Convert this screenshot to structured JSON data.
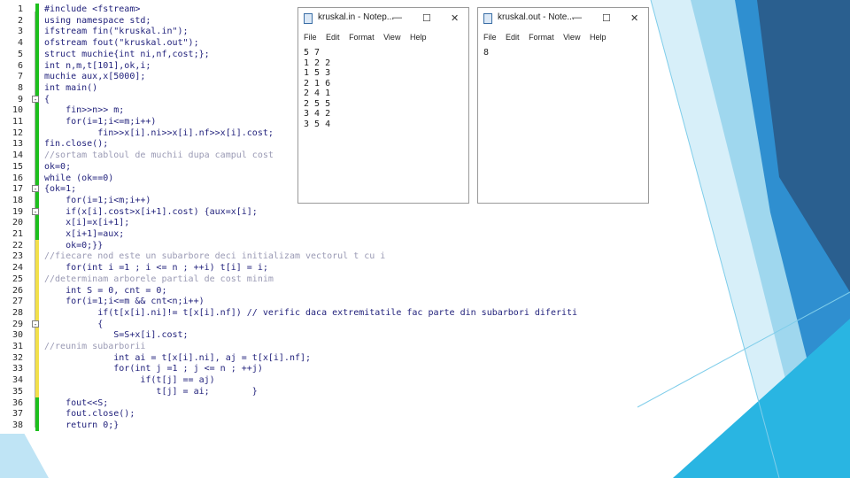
{
  "code_lines": [
    {
      "n": "1",
      "text": "#include <fstream>",
      "color": "plain",
      "bar": "green"
    },
    {
      "n": "2",
      "text": "using namespace std;",
      "color": "plain",
      "bar": "green"
    },
    {
      "n": "3",
      "text": "ifstream fin(\"kruskal.in\");",
      "color": "plain",
      "bar": "green"
    },
    {
      "n": "4",
      "text": "ofstream fout(\"kruskal.out\");",
      "color": "plain",
      "bar": "green"
    },
    {
      "n": "5",
      "text": "struct muchie{int ni,nf,cost;};",
      "color": "plain",
      "bar": "green"
    },
    {
      "n": "6",
      "text": "int n,m,t[101],ok,i;",
      "color": "plain",
      "bar": "green"
    },
    {
      "n": "7",
      "text": "muchie aux,x[5000];",
      "color": "plain",
      "bar": "green"
    },
    {
      "n": "8",
      "text": "int main()",
      "color": "plain",
      "bar": "green"
    },
    {
      "n": "9",
      "text": "{",
      "color": "plain",
      "bar": "green",
      "fold": "-"
    },
    {
      "n": "10",
      "text": "    fin>>n>> m;",
      "color": "plain",
      "bar": "green"
    },
    {
      "n": "11",
      "text": "    for(i=1;i<=m;i++)",
      "color": "plain",
      "bar": "green"
    },
    {
      "n": "12",
      "text": "          fin>>x[i].ni>>x[i].nf>>x[i].cost;",
      "color": "plain",
      "bar": "green"
    },
    {
      "n": "13",
      "text": "fin.close();",
      "color": "plain",
      "bar": "green"
    },
    {
      "n": "14",
      "text": "//sortam tabloul de muchii dupa campul cost",
      "color": "comment",
      "bar": "green"
    },
    {
      "n": "15",
      "text": "ok=0;",
      "color": "plain",
      "bar": "green"
    },
    {
      "n": "16",
      "text": "while (ok==0)",
      "color": "plain",
      "bar": "green"
    },
    {
      "n": "17",
      "text": "{ok=1;",
      "color": "plain",
      "bar": "green",
      "fold": "-"
    },
    {
      "n": "18",
      "text": "    for(i=1;i<m;i++)",
      "color": "plain",
      "bar": "green"
    },
    {
      "n": "19",
      "text": "    if(x[i].cost>x[i+1].cost) {aux=x[i];",
      "color": "plain",
      "bar": "green",
      "fold": "-"
    },
    {
      "n": "20",
      "text": "    x[i]=x[i+1];",
      "color": "plain",
      "bar": "green"
    },
    {
      "n": "21",
      "text": "    x[i+1]=aux;",
      "color": "plain",
      "bar": "green"
    },
    {
      "n": "22",
      "text": "    ok=0;}}",
      "color": "plain",
      "bar": "yellow"
    },
    {
      "n": "23",
      "text": "//fiecare nod este un subarbore deci initializam vectorul t cu i",
      "color": "comment",
      "bar": "yellow"
    },
    {
      "n": "24",
      "text": "    for(int i =1 ; i <= n ; ++i) t[i] = i;",
      "color": "plain",
      "bar": "yellow"
    },
    {
      "n": "25",
      "text": "//determinam arborele partial de cost minim",
      "color": "comment",
      "bar": "yellow"
    },
    {
      "n": "26",
      "text": "    int S = 0, cnt = 0;",
      "color": "plain",
      "bar": "yellow"
    },
    {
      "n": "27",
      "text": "    for(i=1;i<=m && cnt<n;i++)",
      "color": "plain",
      "bar": "yellow"
    },
    {
      "n": "28",
      "text": "          if(t[x[i].ni]!= t[x[i].nf]) // verific daca extremitatile fac parte din subarbori diferiti",
      "color": "plain",
      "bar": "yellow"
    },
    {
      "n": "29",
      "text": "          {",
      "color": "plain",
      "bar": "yellow",
      "fold": "-"
    },
    {
      "n": "30",
      "text": "             S=S+x[i].cost;",
      "color": "plain",
      "bar": "yellow"
    },
    {
      "n": "31",
      "text": "//reunim subarborii",
      "color": "comment",
      "bar": "yellow"
    },
    {
      "n": "32",
      "text": "             int ai = t[x[i].ni], aj = t[x[i].nf];",
      "color": "plain",
      "bar": "yellow"
    },
    {
      "n": "33",
      "text": "             for(int j =1 ; j <= n ; ++j)",
      "color": "plain",
      "bar": "yellow"
    },
    {
      "n": "34",
      "text": "                  if(t[j] == aj)",
      "color": "plain",
      "bar": "yellow"
    },
    {
      "n": "35",
      "text": "                     t[j] = ai;        }",
      "color": "plain",
      "bar": "yellow"
    },
    {
      "n": "36",
      "text": "    fout<<S;",
      "color": "plain",
      "bar": "green"
    },
    {
      "n": "37",
      "text": "    fout.close();",
      "color": "plain",
      "bar": "green"
    },
    {
      "n": "38",
      "text": "    return 0;}",
      "color": "plain",
      "bar": "green"
    }
  ],
  "notepad_in": {
    "title": "kruskal.in - Notep...",
    "menu": [
      "File",
      "Edit",
      "Format",
      "View",
      "Help"
    ],
    "minimize": "—",
    "maximize": "☐",
    "close": "✕",
    "body": "5 7\n1 2 2\n1 5 3\n2 1 6\n2 4 1\n2 5 5\n3 4 2\n3 5 4"
  },
  "notepad_out": {
    "title": "kruskal.out - Note...",
    "menu": [
      "File",
      "Edit",
      "Format",
      "View",
      "Help"
    ],
    "minimize": "—",
    "maximize": "☐",
    "close": "✕",
    "body": "8"
  },
  "colors": {
    "bar_green": "#1ec01e",
    "bar_yellow": "#f2e04a",
    "blue_dark": "#2a5f8f",
    "blue_mid": "#2f8fd0",
    "blue_light": "#bfe4f5",
    "cyan": "#29b5e2"
  },
  "icons": [
    "notepad-icon",
    "minimize-icon",
    "maximize-icon",
    "close-icon",
    "fold-toggle-icon"
  ]
}
